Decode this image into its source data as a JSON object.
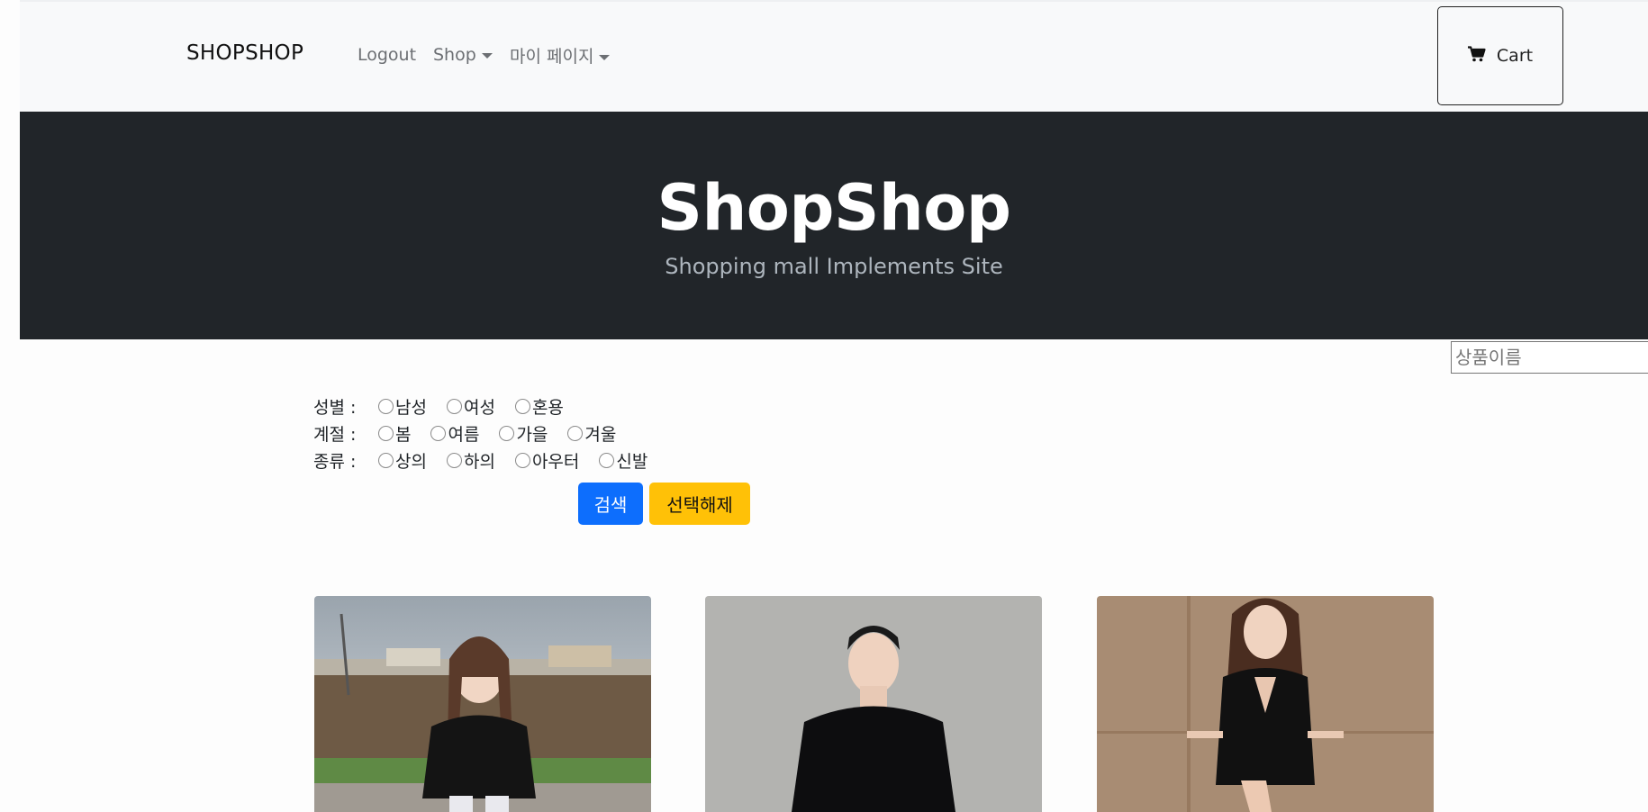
{
  "navbar": {
    "brand": "SHOPSHOP",
    "links": [
      {
        "label": "Logout"
      },
      {
        "label": "Shop"
      },
      {
        "label": "마이 페이지"
      }
    ],
    "cart_label": "Cart"
  },
  "hero": {
    "title": "ShopShop",
    "subtitle": "Shopping mall Implements Site"
  },
  "search": {
    "placeholder": "상품이름"
  },
  "filters": {
    "gender": {
      "label": "성별 :",
      "options": [
        "남성",
        "여성",
        "혼용"
      ]
    },
    "season": {
      "label": "계절 :",
      "options": [
        "봄",
        "여름",
        "가을",
        "겨울"
      ]
    },
    "category": {
      "label": "종류 :",
      "options": [
        "상의",
        "하의",
        "아우터",
        "신발"
      ]
    }
  },
  "buttons": {
    "search": "검색",
    "clear": "선택해제"
  },
  "colors": {
    "primary": "#0d6efd",
    "warning": "#ffc107",
    "dark": "#212529"
  },
  "products": [
    {
      "image": "woman-black-sweater-outdoor"
    },
    {
      "image": "man-black-sweater-wall"
    },
    {
      "image": "woman-black-blazer-dress"
    }
  ]
}
